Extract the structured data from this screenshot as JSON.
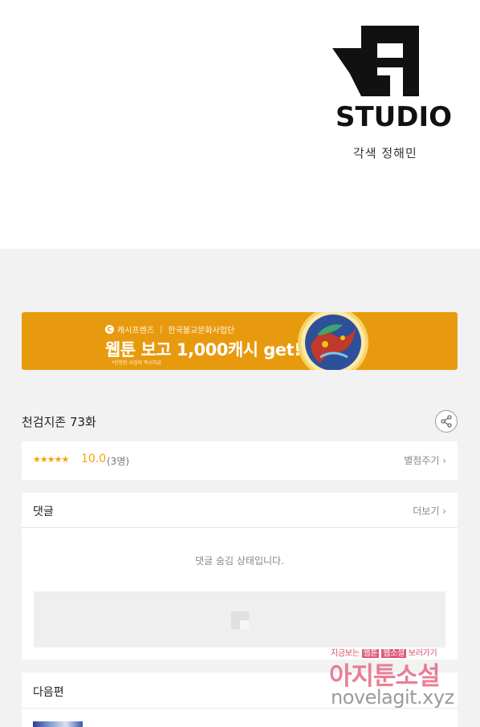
{
  "header": {
    "logo_word": "STUDIO",
    "credit": "각색 정해민"
  },
  "banner": {
    "brand": "캐시프렌즈",
    "partner": "한국불교문화사업단",
    "headline": "웹툰 보고 1,000캐시 get!",
    "fine_print": "*한정된 사업비 즉시지급",
    "colors": {
      "background": "#e89a0e",
      "text": "#ffffff"
    }
  },
  "episode": {
    "title": "천검지존 73화",
    "share_icon": "share-icon"
  },
  "rating": {
    "stars": "★★★★★",
    "score": "10.0",
    "count": "(3명)",
    "action": "별점주기 ›",
    "accent": "#f5a300"
  },
  "comments": {
    "title": "댓글",
    "more": "더보기 ›",
    "hidden_message": "댓글 숨김 상태입니다."
  },
  "next": {
    "title": "다음편"
  },
  "watermark": {
    "tagline_pre": "지금보는",
    "tagline_hl1": "웹툰",
    "tagline_mid": "웹소설",
    "tagline_post": "보러가기",
    "main": "아지툰소설",
    "url": "novelagit.xyz"
  }
}
